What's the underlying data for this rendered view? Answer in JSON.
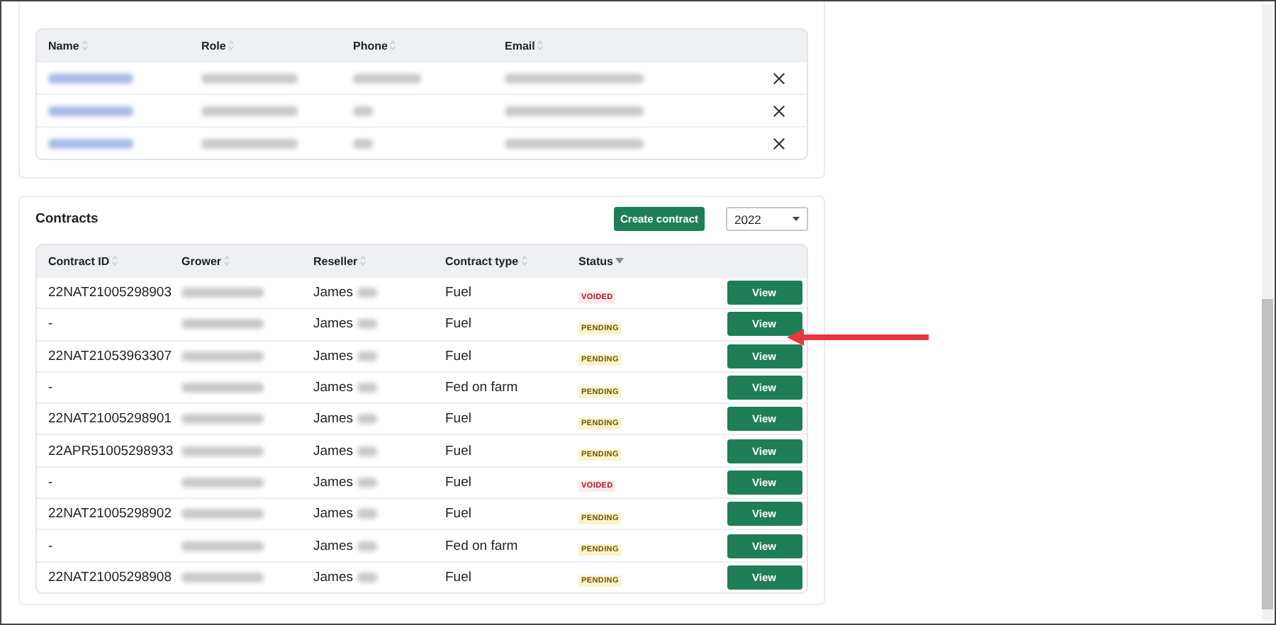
{
  "contacts": {
    "columns": [
      {
        "label": "Name"
      },
      {
        "label": "Role"
      },
      {
        "label": "Phone"
      },
      {
        "label": "Email"
      }
    ],
    "rows": [
      {
        "kind": "blurred"
      },
      {
        "kind": "blurred"
      },
      {
        "kind": "blurred"
      }
    ]
  },
  "contracts": {
    "title": "Contracts",
    "create_button": "Create contract",
    "year": "2022",
    "columns": [
      {
        "label": "Contract ID",
        "sorted": false
      },
      {
        "label": "Grower",
        "sorted": false
      },
      {
        "label": "Reseller",
        "sorted": false
      },
      {
        "label": "Contract type",
        "sorted": false
      },
      {
        "label": "Status",
        "sorted": true
      }
    ],
    "rows": [
      {
        "id": "22NAT21005298903",
        "reseller": "James",
        "type": "Fuel",
        "status": {
          "label": "VOIDED",
          "kind": "voided"
        },
        "action": "View",
        "highlighted": false
      },
      {
        "id": "-",
        "reseller": "James",
        "type": "Fuel",
        "status": {
          "label": "PENDING",
          "kind": "pending"
        },
        "action": "View",
        "highlighted": true
      },
      {
        "id": "22NAT21053963307",
        "reseller": "James",
        "type": "Fuel",
        "status": {
          "label": "PENDING",
          "kind": "pending"
        },
        "action": "View",
        "highlighted": false
      },
      {
        "id": "-",
        "reseller": "James",
        "type": "Fed on farm",
        "status": {
          "label": "PENDING",
          "kind": "pending"
        },
        "action": "View",
        "highlighted": false
      },
      {
        "id": "22NAT21005298901",
        "reseller": "James",
        "type": "Fuel",
        "status": {
          "label": "PENDING",
          "kind": "pending"
        },
        "action": "View",
        "highlighted": false
      },
      {
        "id": "22APR51005298933",
        "reseller": "James",
        "type": "Fuel",
        "status": {
          "label": "PENDING",
          "kind": "pending"
        },
        "action": "View",
        "highlighted": false
      },
      {
        "id": "-",
        "reseller": "James",
        "type": "Fuel",
        "status": {
          "label": "VOIDED",
          "kind": "voided"
        },
        "action": "View",
        "highlighted": false
      },
      {
        "id": "22NAT21005298902",
        "reseller": "James",
        "type": "Fuel",
        "status": {
          "label": "PENDING",
          "kind": "pending"
        },
        "action": "View",
        "highlighted": false
      },
      {
        "id": "-",
        "reseller": "James",
        "type": "Fed on farm",
        "status": {
          "label": "PENDING",
          "kind": "pending"
        },
        "action": "View",
        "highlighted": false
      },
      {
        "id": "22NAT21005298908",
        "reseller": "James",
        "type": "Fuel",
        "status": {
          "label": "PENDING",
          "kind": "pending"
        },
        "action": "View",
        "highlighted": false
      }
    ]
  }
}
